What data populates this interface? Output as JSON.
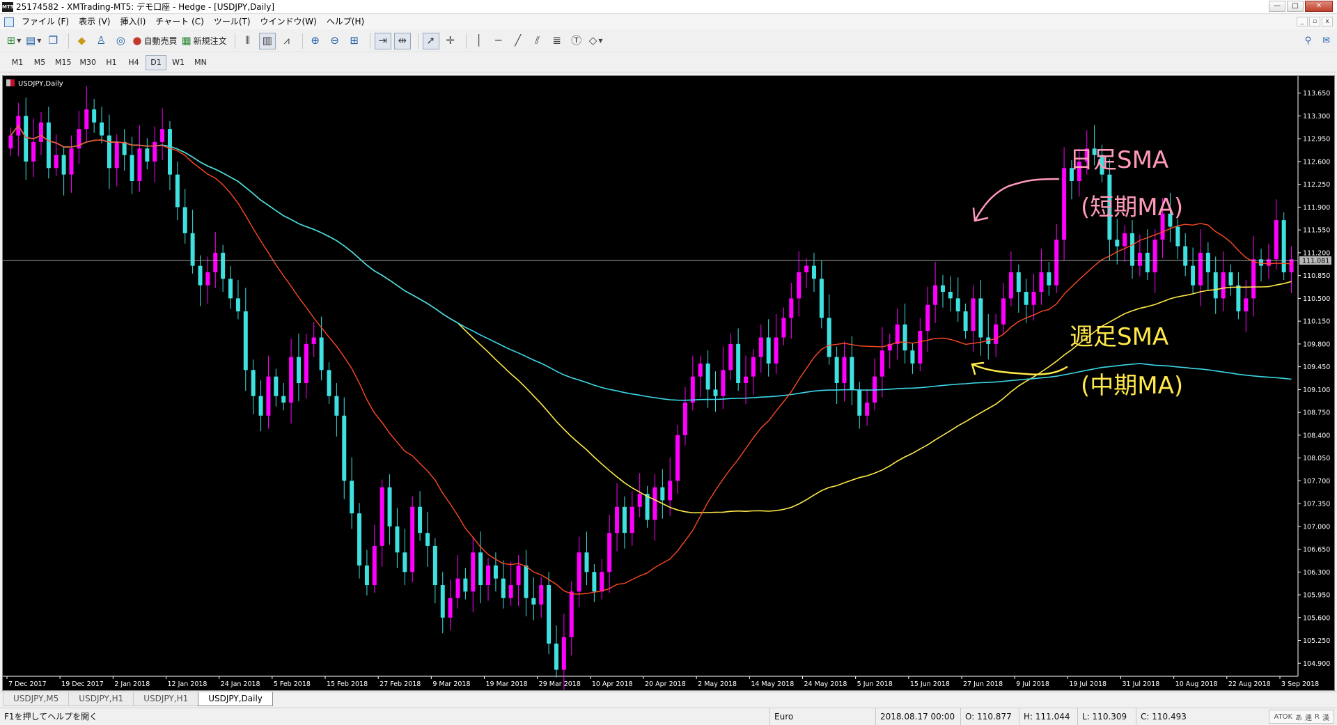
{
  "window": {
    "title": "25174582 - XMTrading-MT5: デモ口座 - Hedge - [USDJPY,Daily]",
    "logo_text": "MT5",
    "minimize": "—",
    "maximize": "□",
    "close": "✕"
  },
  "menu": {
    "items": [
      "ファイル (F)",
      "表示 (V)",
      "挿入(I)",
      "チャート (C)",
      "ツール(T)",
      "ウインドウ(W)",
      "ヘルプ(H)"
    ],
    "mdi_min": "_",
    "mdi_restore": "▫",
    "mdi_close": "x"
  },
  "toolbar": {
    "auto_trade_label": "自動売買",
    "new_order_label": "新規注文",
    "right_icons": [
      "search-icon",
      "chat-icon"
    ]
  },
  "timeframes": {
    "items": [
      "M1",
      "M5",
      "M15",
      "M30",
      "H1",
      "H4",
      "D1",
      "W1",
      "MN"
    ],
    "active": "D1"
  },
  "chart": {
    "symbol_label": "USDJPY,Daily",
    "colors": {
      "background": "#000000",
      "bull": "#ff00ff",
      "bear": "#3fe0e0",
      "sma_short": "#ff4a24",
      "sma_mid": "#ffe94a",
      "sma_long": "#3cd8e8",
      "text": "#ffffff",
      "annot_pink": "#ff9ab8",
      "annot_yellow": "#ffe94a"
    },
    "annotations": {
      "daily_sma": "日足SMA",
      "short_ma": "(短期MA)",
      "weekly_sma": "週足SMA",
      "mid_ma": "(中期MA)"
    },
    "current_price_label": "111.081"
  },
  "chart_data": {
    "type": "candlestick",
    "ylim": [
      104.7,
      113.85
    ],
    "y_ticks": [
      "113.650",
      "113.300",
      "112.950",
      "112.600",
      "112.250",
      "111.900",
      "111.550",
      "111.200",
      "110.850",
      "110.500",
      "110.150",
      "109.800",
      "109.450",
      "109.100",
      "108.750",
      "108.400",
      "108.050",
      "107.700",
      "107.350",
      "107.000",
      "106.650",
      "106.300",
      "105.950",
      "105.600",
      "105.250",
      "104.900"
    ],
    "x_ticks": [
      "7 Dec 2017",
      "19 Dec 2017",
      "2 Jan 2018",
      "12 Jan 2018",
      "24 Jan 2018",
      "5 Feb 2018",
      "15 Feb 2018",
      "27 Feb 2018",
      "9 Mar 2018",
      "19 Mar 2018",
      "29 Mar 2018",
      "10 Apr 2018",
      "20 Apr 2018",
      "2 May 2018",
      "14 May 2018",
      "24 May 2018",
      "5 Jun 2018",
      "15 Jun 2018",
      "27 Jun 2018",
      "9 Jul 2018",
      "19 Jul 2018",
      "31 Jul 2018",
      "10 Aug 2018",
      "22 Aug 2018",
      "3 Sep 2018"
    ],
    "current_price": 111.081,
    "closes": [
      113.0,
      113.3,
      112.6,
      112.9,
      113.2,
      112.5,
      112.7,
      112.4,
      112.8,
      113.1,
      113.4,
      113.2,
      113.0,
      112.5,
      112.9,
      112.7,
      112.3,
      112.8,
      112.6,
      112.9,
      113.1,
      112.4,
      111.9,
      111.5,
      111.0,
      110.7,
      110.9,
      111.2,
      110.8,
      110.5,
      110.3,
      109.4,
      109.0,
      108.7,
      109.3,
      109.0,
      108.9,
      109.6,
      109.2,
      109.8,
      109.9,
      109.4,
      109.0,
      108.7,
      107.7,
      107.2,
      106.4,
      106.1,
      106.7,
      107.6,
      107.0,
      106.6,
      106.3,
      107.3,
      106.9,
      106.7,
      106.1,
      105.6,
      105.9,
      106.2,
      106.0,
      106.6,
      106.1,
      106.4,
      106.2,
      105.9,
      106.1,
      106.4,
      105.9,
      105.8,
      106.1,
      105.2,
      104.8,
      105.3,
      106.0,
      106.6,
      106.3,
      106.0,
      106.3,
      106.9,
      107.3,
      106.9,
      107.3,
      107.5,
      107.1,
      107.6,
      107.4,
      107.7,
      108.4,
      108.9,
      109.3,
      109.5,
      109.1,
      109.0,
      109.4,
      109.8,
      109.2,
      109.3,
      109.6,
      109.9,
      109.5,
      109.9,
      110.2,
      110.5,
      110.9,
      111.0,
      110.8,
      110.2,
      109.6,
      109.2,
      109.6,
      109.1,
      108.7,
      108.9,
      109.3,
      109.7,
      109.8,
      110.1,
      109.7,
      109.5,
      110.0,
      110.4,
      110.7,
      110.6,
      110.5,
      110.3,
      110.0,
      110.5,
      109.9,
      109.8,
      110.1,
      110.5,
      110.9,
      110.6,
      110.4,
      110.6,
      110.9,
      110.7,
      111.4,
      112.5,
      112.3,
      112.6,
      112.8,
      112.7,
      112.4,
      111.4,
      111.3,
      111.5,
      111.0,
      111.2,
      110.9,
      111.4,
      111.8,
      111.6,
      111.3,
      111.0,
      110.7,
      111.2,
      110.9,
      110.5,
      110.9,
      110.7,
      110.3,
      110.5,
      111.1,
      111.0,
      111.1,
      111.7,
      110.9,
      111.1
    ]
  }
}
